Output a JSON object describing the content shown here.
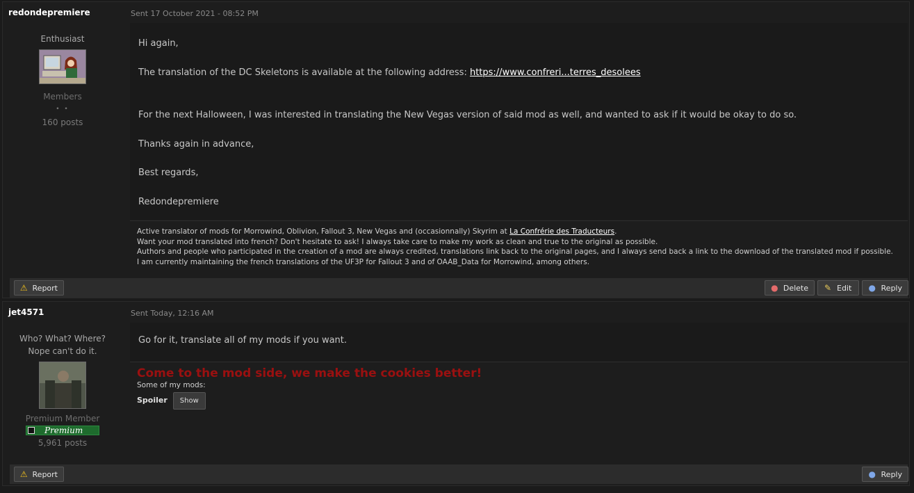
{
  "posts": [
    {
      "author": "redondepremiere",
      "date": "Sent 17 October 2021 - 08:52 PM",
      "title": "Enthusiast",
      "group": "Members",
      "pips": "• •",
      "post_count": "160 posts",
      "message": {
        "greeting": "Hi again,",
        "translation_text": "The translation of the DC Skeletons is available at the following address: ",
        "translation_link": "https://www.confreri...terres_desolees",
        "halloween": "For the next Halloween, I was interested in translating the New Vegas version of said mod as well, and wanted to ask if it would be okay to do so.",
        "thanks": "Thanks again in advance,",
        "regards": "Best regards,",
        "signoff": "Redondepremiere"
      },
      "signature": {
        "line1_text": "Active translator of mods for Morrowind, Oblivion, Fallout 3, New Vegas and (occasionnally) Skyrim  at ",
        "line1_link": "La Confrérie des Traducteurs",
        "line1_end": ".",
        "line2": "Want your mod translated into french? Don't hesitate to ask! I always take care to make my work as clean and true to the original as possible.",
        "line3": "Authors and people who participated in the creation of a mod are always credited, translations link back to the original pages, and I always send back a link to the download of the translated mod if possible.",
        "line4": "I am currently maintaining the french translations of the UF3P for Fallout 3 and of OAAB_Data for Morrowind, among others."
      },
      "controls": {
        "report": "Report",
        "delete": "Delete",
        "edit": "Edit",
        "reply": "Reply"
      }
    },
    {
      "author": "jet4571",
      "date": "Sent Today, 12:16 AM",
      "title": "Who? What? Where? Nope can't do it.",
      "group": "Premium Member",
      "badge": "Premium",
      "post_count": "5,961 posts",
      "message": {
        "text": "Go for it, translate all of my mods if you want."
      },
      "signature": {
        "headline": "Come to the mod side, we make the cookies better!",
        "mods_label": "Some of my mods:",
        "spoiler_label": "Spoiler",
        "show_button": "Show"
      },
      "controls": {
        "report": "Report",
        "reply": "Reply"
      }
    }
  ],
  "colors": {
    "background": "#1b1b1b",
    "link": "#ffffff",
    "cookie_text": "#9a1010",
    "premium_badge": "#1e6b2d"
  },
  "icons": {
    "report": "warning-icon",
    "delete": "speech-bubble-delete-icon",
    "edit": "magnifier-edit-icon",
    "reply": "reply-bubble-icon"
  }
}
